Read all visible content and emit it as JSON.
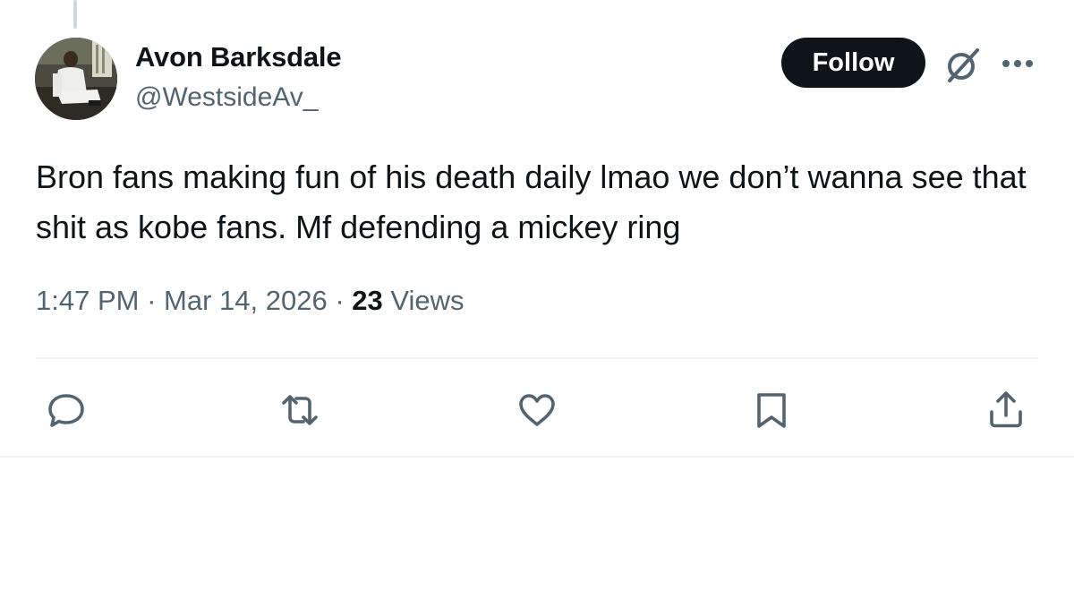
{
  "author": {
    "display_name": "Avon Barksdale",
    "handle": "@WestsideAv_"
  },
  "header": {
    "follow_label": "Follow",
    "icons": [
      "grok-icon",
      "more-icon"
    ]
  },
  "tweet": {
    "text": "Bron fans making fun of his death daily lmao we don’t wanna see that shit as kobe fans. Mf defending a mickey ring",
    "time": "1:47 PM",
    "date": "Mar 14, 2026",
    "separator": "·",
    "views_count": "23",
    "views_label": "Views"
  },
  "actions": [
    "reply-icon",
    "retweet-icon",
    "like-icon",
    "bookmark-icon",
    "share-icon"
  ],
  "colors": {
    "text_primary": "#0f1419",
    "text_secondary": "#536471",
    "divider": "#eff3f4",
    "button_bg": "#0f1419"
  }
}
